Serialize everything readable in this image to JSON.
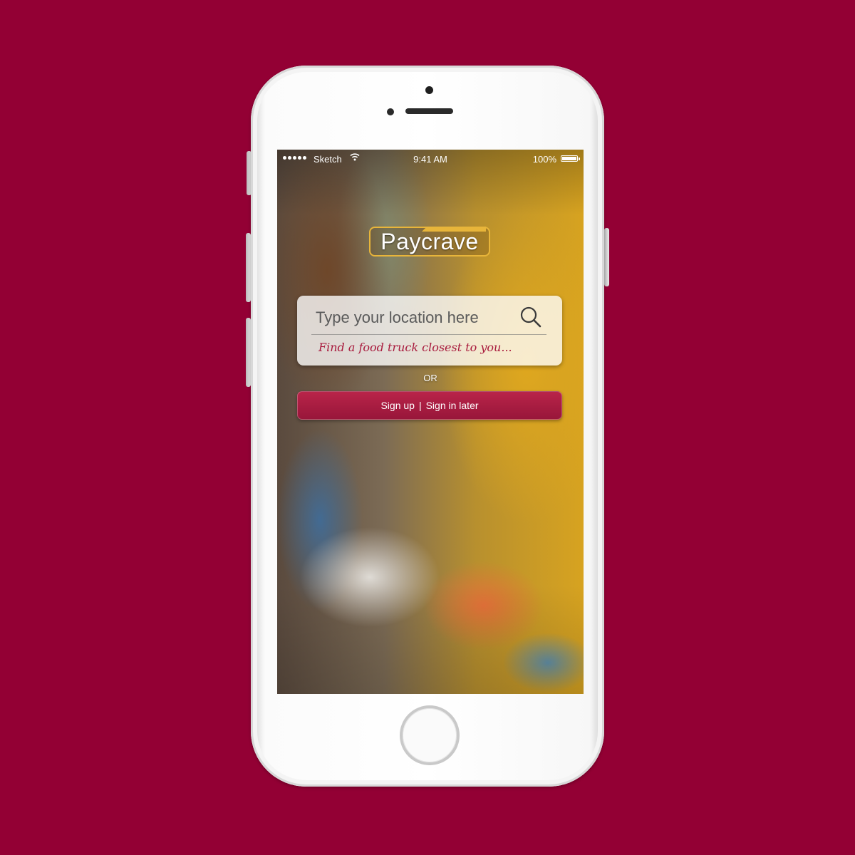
{
  "background_color": "#930034",
  "status_bar": {
    "carrier": "Sketch",
    "time": "9:41 AM",
    "battery": "100%",
    "battery_level": 1.0
  },
  "app": {
    "logo": "Paycrave",
    "logo_accent_color": "#e8b53a"
  },
  "search": {
    "placeholder": "Type your location here",
    "tagline": "Find a food truck closest to you...",
    "tagline_color": "#a8193c"
  },
  "divider_text": "OR",
  "auth": {
    "sign_up_label": "Sign up",
    "separator": "|",
    "sign_in_later_label": "Sign in later",
    "button_color": "#a81d42"
  }
}
